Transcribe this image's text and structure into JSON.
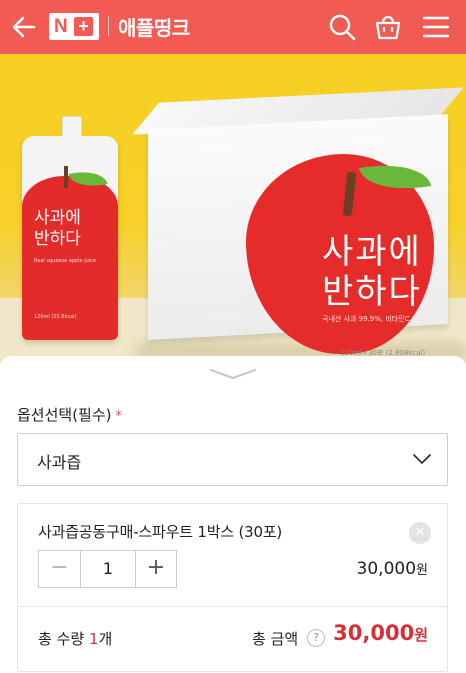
{
  "header": {
    "logo_text": "N",
    "logo_plus": "+",
    "store_name": "애플띵크",
    "icons": [
      "back-arrow-icon",
      "search-icon",
      "shopping-bag-icon",
      "hamburger-menu-icon"
    ]
  },
  "hero": {
    "pouch": {
      "title_line1": "사과에",
      "title_line2": "반하다",
      "subtitle": "Real squeeze apple juice",
      "volume": "120ml (55.6kcal)"
    },
    "box": {
      "title_line1": "사과에",
      "title_line2": "반하다",
      "subtitle": "국내산 사과 99.9%, 비타민C 0.1%",
      "bottom": "120ml×30포 (2,808kcal)"
    }
  },
  "options": {
    "label": "옵션선택(필수)",
    "required_mark": "*",
    "selected": "사과즙"
  },
  "selected_item": {
    "name": "사과즙공동구매-스파우트 1박스 (30포)",
    "quantity": "1",
    "minus": "−",
    "plus": "+",
    "remove": "✕",
    "price": "30,000",
    "currency": "원"
  },
  "total": {
    "qty_label": "총 수량",
    "qty_value": "1",
    "qty_unit": "개",
    "amount_label": "총 금액",
    "help": "?",
    "amount": "30,000",
    "currency": "원"
  },
  "colors": {
    "brand": "#f25a54",
    "accent_price": "#d3323a",
    "hero_bg": "#f6cf22"
  }
}
